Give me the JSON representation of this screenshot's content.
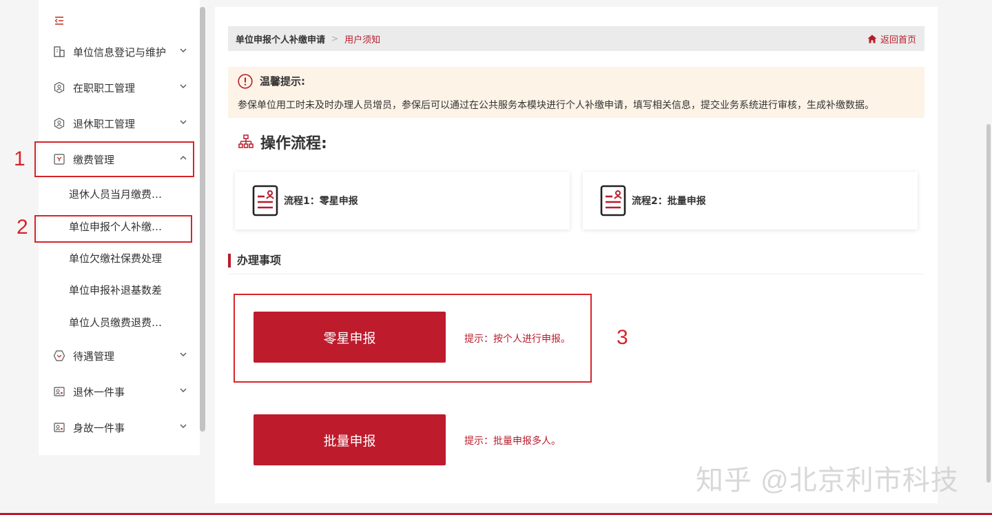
{
  "sidebar": {
    "items": [
      {
        "label": "单位信息登记与维护",
        "icon": "building-icon"
      },
      {
        "label": "在职职工管理",
        "icon": "staff-icon"
      },
      {
        "label": "退休职工管理",
        "icon": "retiree-icon"
      },
      {
        "label": "缴费管理",
        "icon": "payment-icon",
        "expanded": true
      },
      {
        "label": "待遇管理",
        "icon": "benefit-icon"
      },
      {
        "label": "退休一件事",
        "icon": "retire-case-icon"
      },
      {
        "label": "身故一件事",
        "icon": "death-case-icon"
      }
    ],
    "sub_items": [
      "退休人员当月缴费…",
      "单位申报个人补缴…",
      "单位欠缴社保费处理",
      "单位申报补退基数差",
      "单位人员缴费退费…"
    ]
  },
  "annotations": {
    "one": "1",
    "two": "2",
    "three": "3"
  },
  "breadcrumb": {
    "first": "单位申报个人补缴申请",
    "separator": ">",
    "current": "用户须知",
    "home": "返回首页"
  },
  "notice": {
    "title": "温馨提示:",
    "text": "参保单位用工时未及时办理人员增员，参保后可以通过在公共服务本模块进行个人补缴申请，填写相关信息，提交业务系统进行审核，生成补缴数据。"
  },
  "process": {
    "heading": "操作流程:",
    "steps": [
      "流程1：零星申报",
      "流程2：批量申报"
    ]
  },
  "section": {
    "title": "办理事项"
  },
  "actions": [
    {
      "label": "零星申报",
      "tip": "提示：按个人进行申报。"
    },
    {
      "label": "批量申报",
      "tip": "提示：批量申报多人。"
    }
  ],
  "watermark": "知乎 @北京利市科技",
  "colors": {
    "accent": "#be1b2d",
    "annotation": "#d8232a",
    "notice_bg": "#fdf3e7"
  }
}
